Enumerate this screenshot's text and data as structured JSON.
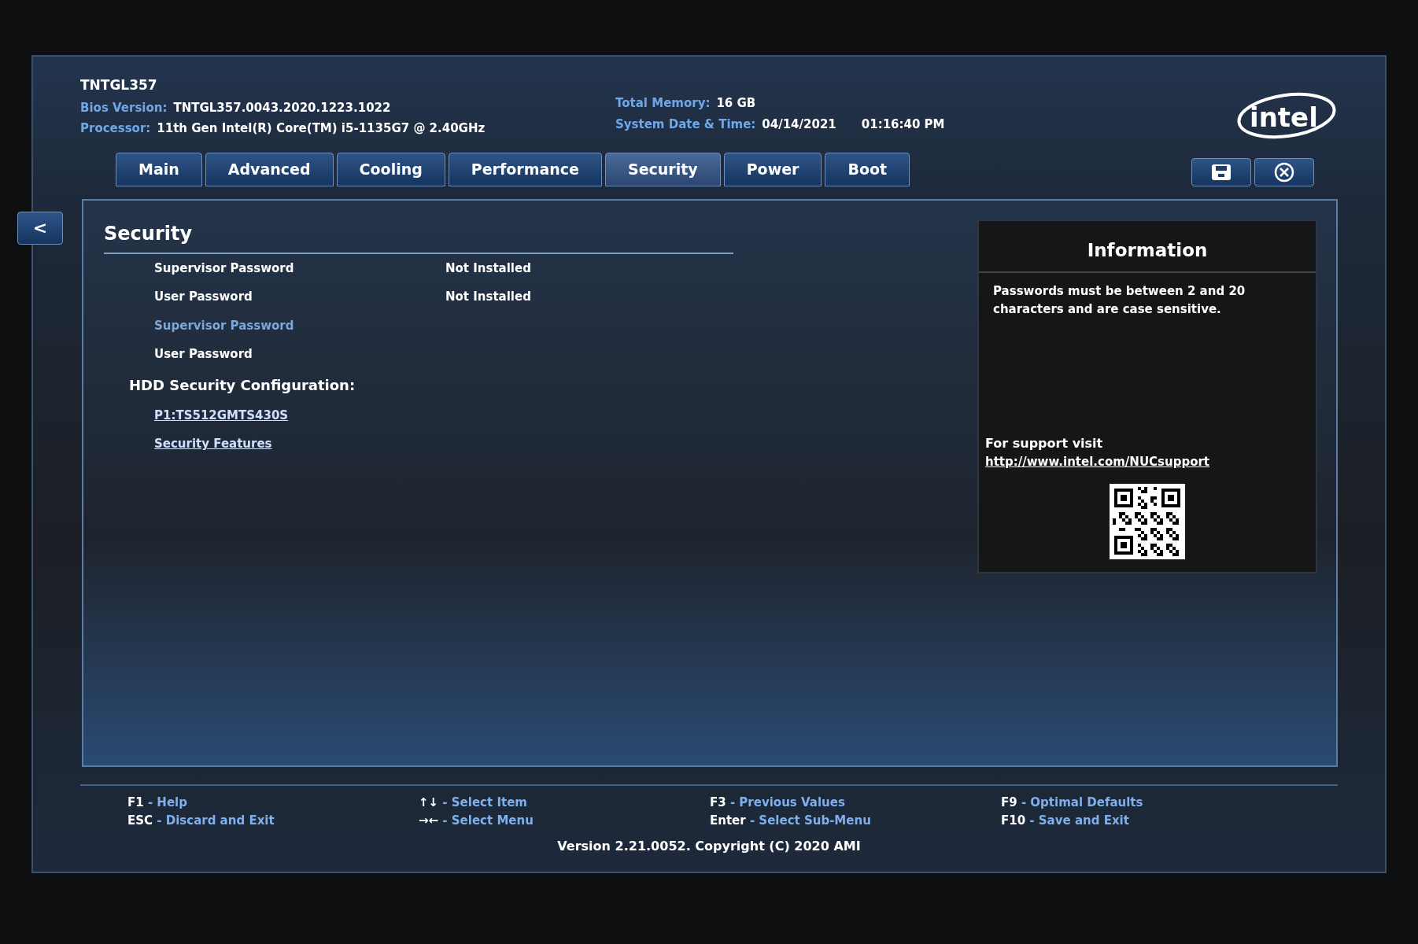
{
  "header": {
    "model": "TNTGL357",
    "info_left": [
      {
        "label": "Bios Version:",
        "value": "TNTGL357.0043.2020.1223.1022"
      },
      {
        "label": "Processor:",
        "value": "11th Gen Intel(R) Core(TM) i5-1135G7 @ 2.40GHz"
      }
    ],
    "info_right": [
      {
        "label": "Total Memory:",
        "value": "16 GB"
      },
      {
        "label": "System Date & Time:",
        "value": "04/14/2021",
        "extra": "01:16:40 PM"
      }
    ],
    "logo": "intel"
  },
  "tabs": [
    {
      "label": "Main",
      "selected": false
    },
    {
      "label": "Advanced",
      "selected": false
    },
    {
      "label": "Cooling",
      "selected": false
    },
    {
      "label": "Performance",
      "selected": false
    },
    {
      "label": "Security",
      "selected": true
    },
    {
      "label": "Power",
      "selected": false
    },
    {
      "label": "Boot",
      "selected": false
    }
  ],
  "back_button": "<",
  "panel": {
    "title": "Security",
    "items": [
      {
        "kind": "setting",
        "label": "Supervisor Password",
        "value": "Not Installed",
        "selected": false
      },
      {
        "kind": "setting",
        "label": "User Password",
        "value": "Not Installed",
        "selected": false
      },
      {
        "kind": "setting",
        "label": "Supervisor Password",
        "selected": true
      },
      {
        "kind": "setting",
        "label": "User Password",
        "selected": false
      },
      {
        "kind": "heading",
        "label": "HDD Security Configuration:",
        "selected": false
      },
      {
        "kind": "link",
        "label": "P1:TS512GMTS430S",
        "selected": false
      },
      {
        "kind": "link",
        "label": "Security Features",
        "selected": false
      }
    ]
  },
  "information": {
    "title": "Information",
    "text": "Passwords must be between 2 and 20 characters and are case sensitive.",
    "support_label": "For support visit",
    "support_link": "http://www.intel.com/NUCsupport"
  },
  "footer": {
    "hint_columns": [
      [
        "**F1** - Help",
        "**ESC** - Discard and Exit"
      ],
      [
        "**↑↓** - Select Item",
        "**→←** - Select Menu"
      ],
      [
        "**F3** - Previous Values",
        "**Enter** - Select Sub-Menu"
      ],
      [
        "**F9** - Optimal Defaults",
        "**F10** - Save and Exit"
      ]
    ],
    "version": "Version 2.21.0052. Copyright (C) 2020 AMI"
  }
}
